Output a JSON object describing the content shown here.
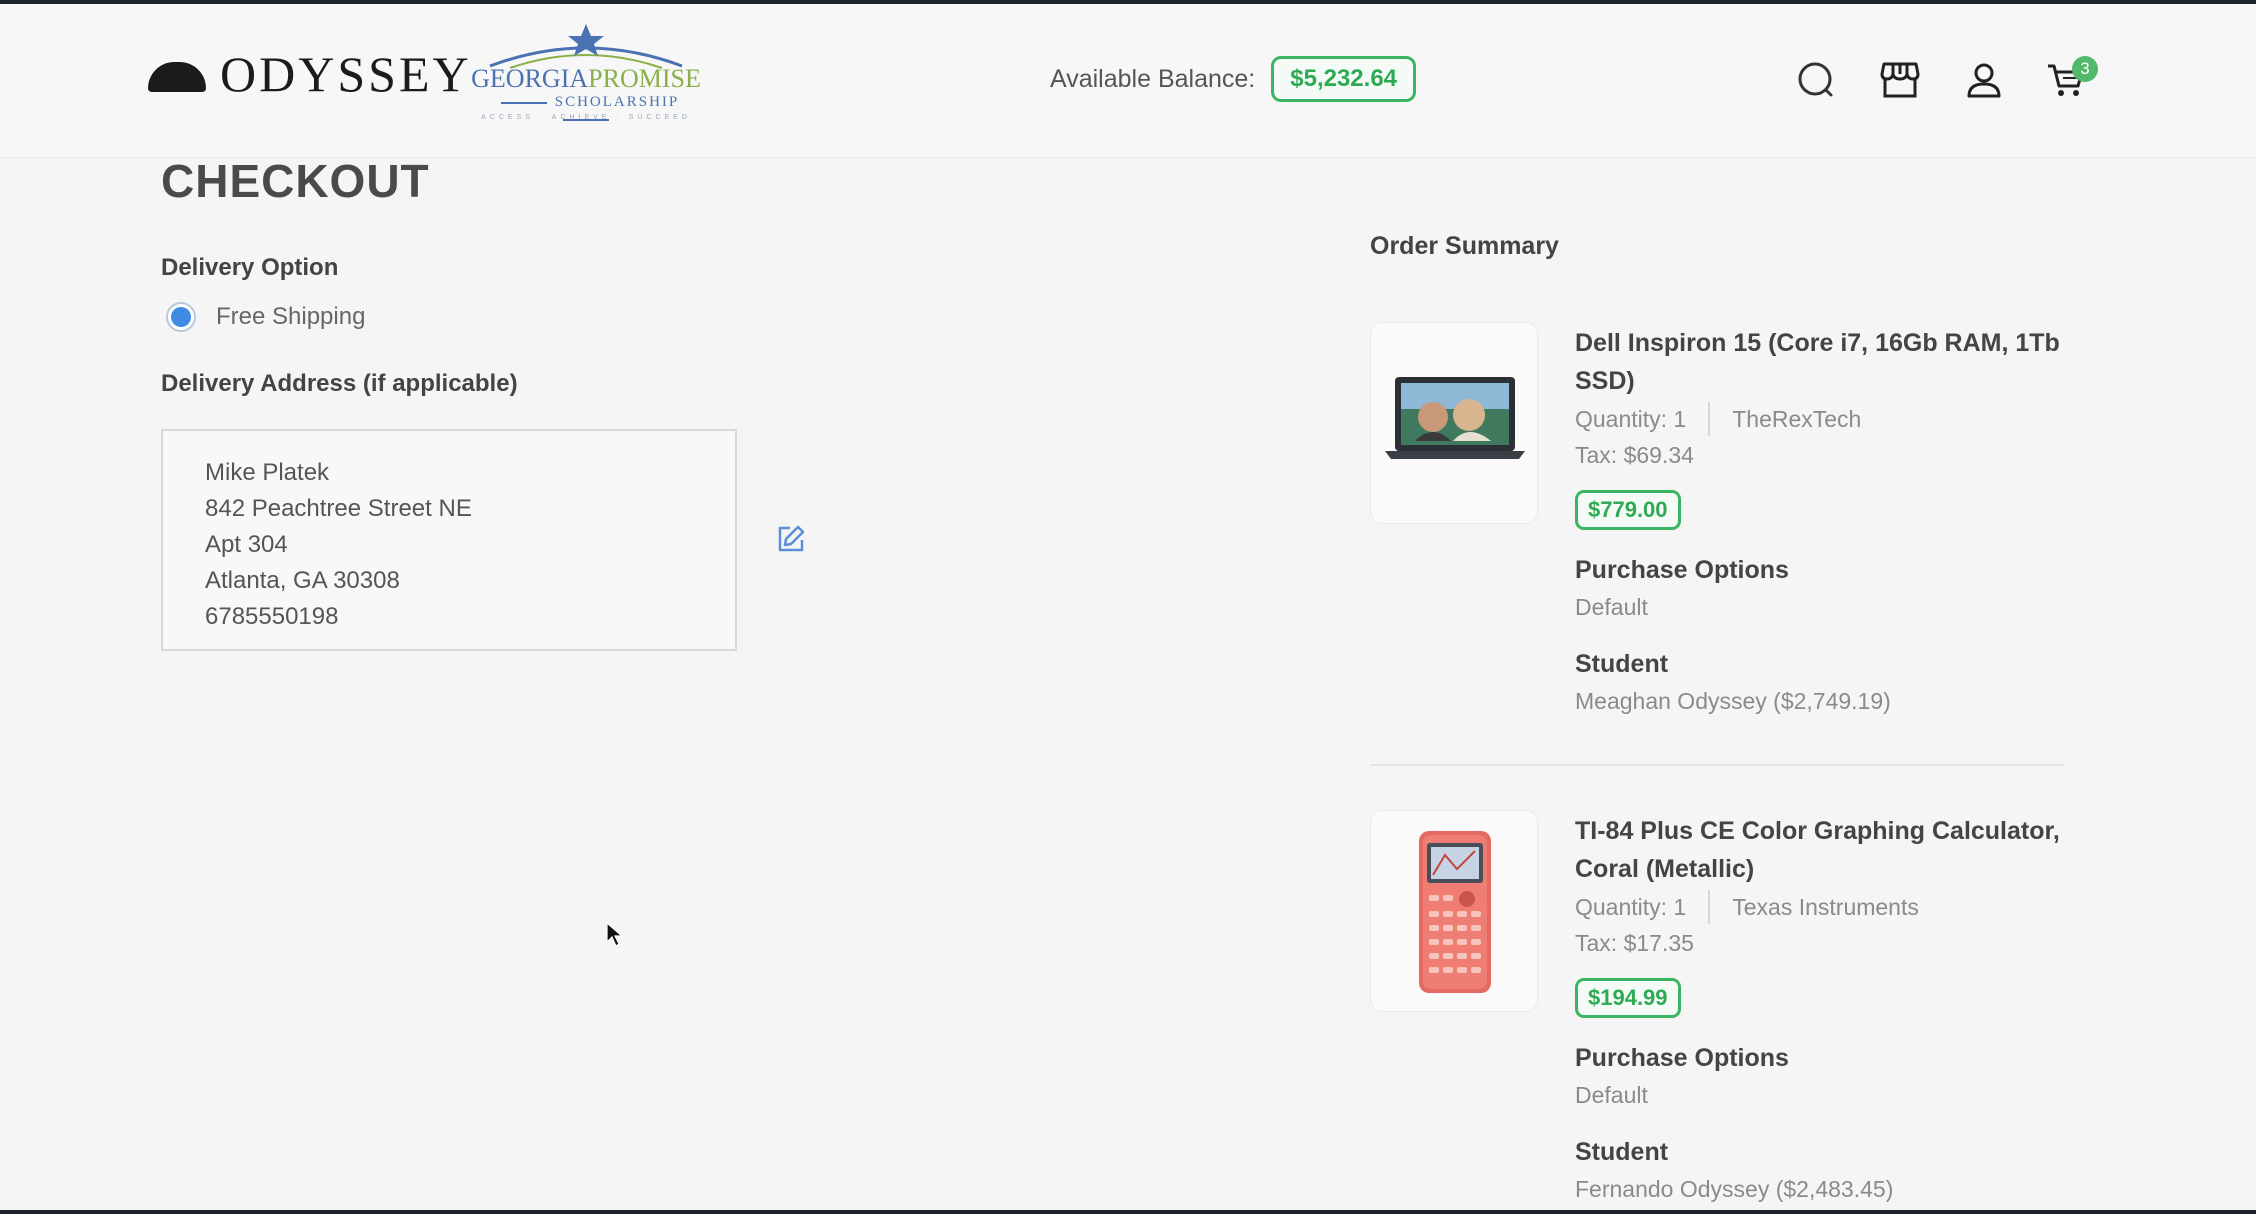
{
  "header": {
    "brand": "ODYSSEY",
    "partner_logo": {
      "line1a": "GEORGIA",
      "line1b": "PROMISE",
      "line2": "SCHOLARSHIP",
      "tagline": "ACCESS · ACHIEVE · SUCCEED"
    },
    "balance_label": "Available Balance:",
    "balance_value": "$5,232.64",
    "cart_count": "3",
    "icons": [
      "search-icon",
      "store-icon",
      "user-icon",
      "cart-icon"
    ],
    "accent_color": "#3cb563"
  },
  "checkout": {
    "title": "CHECKOUT",
    "delivery_option_label": "Delivery Option",
    "delivery_option_value": "Free Shipping",
    "delivery_address_label": "Delivery Address (if applicable)",
    "address_lines": [
      "Mike Platek",
      "842 Peachtree Street NE",
      "Apt 304",
      "Atlanta, GA 30308",
      "6785550198"
    ]
  },
  "order_summary": {
    "title": "Order Summary",
    "items": [
      {
        "name": "Dell Inspiron 15 (Core i7, 16Gb RAM, 1Tb SSD)",
        "quantity": "Quantity: 1",
        "vendor": "TheRexTech",
        "tax": "Tax: $69.34",
        "price": "$779.00",
        "purchase_options_label": "Purchase Options",
        "purchase_options_value": "Default",
        "student_label": "Student",
        "student_value": "Meaghan Odyssey ($2,749.19)"
      },
      {
        "name": "TI-84 Plus CE Color Graphing Calculator, Coral (Metallic)",
        "quantity": "Quantity: 1",
        "vendor": "Texas Instruments",
        "tax": "Tax: $17.35",
        "price": "$194.99",
        "purchase_options_label": "Purchase Options",
        "purchase_options_value": "Default",
        "student_label": "Student",
        "student_value": "Fernando Odyssey ($2,483.45)"
      }
    ]
  }
}
